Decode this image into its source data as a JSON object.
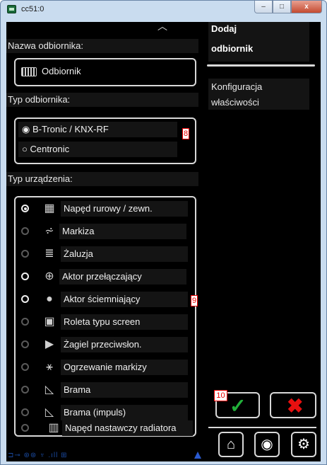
{
  "window": {
    "title": "cc51:0",
    "minimize": "–",
    "maximize": "□",
    "close": "x"
  },
  "scroll_up": "︿",
  "left": {
    "name_label": "Nazwa odbiornika:",
    "name_value": "Odbiornik",
    "type_label": "Typ odbiornika:",
    "type_options": [
      "B-Tronic / KNX-RF",
      "Centronic"
    ],
    "type_marker": "8",
    "device_label": "Typ urządzenia:",
    "device_marker": "9",
    "devices": [
      {
        "label": "Napęd rurowy / zewn.",
        "icon": "▦"
      },
      {
        "label": "Markiza",
        "icon": "⩫"
      },
      {
        "label": "Żaluzja",
        "icon": "≣"
      },
      {
        "label": "Aktor przełączający",
        "icon": "⊕"
      },
      {
        "label": "Aktor ściemniający",
        "icon": "●"
      },
      {
        "label": "Roleta typu screen",
        "icon": "▣"
      },
      {
        "label": "Żagiel przeciwsłon.",
        "icon": "▶"
      },
      {
        "label": "Ogrzewanie markizy",
        "icon": "⚹"
      },
      {
        "label": "Brama",
        "icon": "◺"
      },
      {
        "label": "Brama (impuls)",
        "icon": "◺"
      },
      {
        "label": "Napęd nastawczy radiatora",
        "icon": "▥"
      }
    ],
    "status_text": "⊐⊸ ⊛⊛ ♆ .ıll ⊞"
  },
  "right": {
    "title_line1": "Dodaj",
    "title_line2": "odbiornik",
    "config_line1": "Konfiguracja",
    "config_line2": "właściwości",
    "marker": "10",
    "ok_icon": "✓",
    "cancel_icon": "✖",
    "home_icon": "⌂",
    "globe_icon": "◉",
    "settings_icon": "⚙"
  },
  "colors": {
    "ok": "#22b03a",
    "cancel": "#e81010",
    "background": "#000000",
    "frame": "#d8d8d8"
  }
}
